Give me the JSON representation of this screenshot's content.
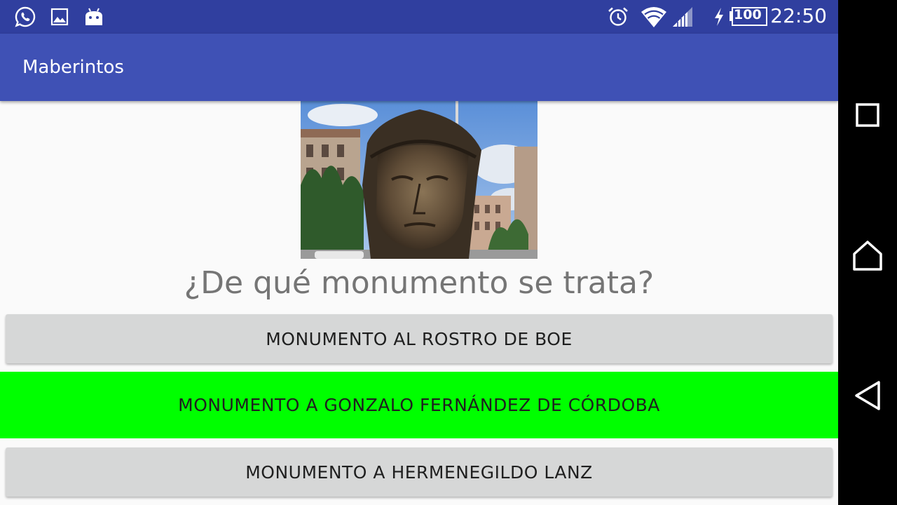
{
  "status_bar": {
    "left_icons": [
      "whatsapp-icon",
      "gallery-icon",
      "android-icon"
    ],
    "right_icons": [
      "alarm-icon",
      "wifi-icon",
      "signal-icon",
      "charging-icon",
      "battery-icon"
    ],
    "battery_level": "100",
    "time": "22:50"
  },
  "app_bar": {
    "title": "Maberintos"
  },
  "quiz": {
    "question": "¿De qué monumento se trata?",
    "answers": [
      {
        "label": "MONUMENTO AL ROSTRO DE BOE"
      },
      {
        "label": "MONUMENTO A GONZALO FERNÁNDEZ DE CÓRDOBA"
      },
      {
        "label": "MONUMENTO A HERMENEGILDO LANZ"
      }
    ],
    "correct_answer_color": "#00ff00",
    "default_answer_color": "#d6d7d7"
  },
  "colors": {
    "status_bar": "#303f9f",
    "app_bar": "#3f51b5",
    "background": "#fafafa"
  },
  "nav_bar": {
    "buttons": [
      "recents-icon",
      "home-icon",
      "back-icon"
    ]
  }
}
